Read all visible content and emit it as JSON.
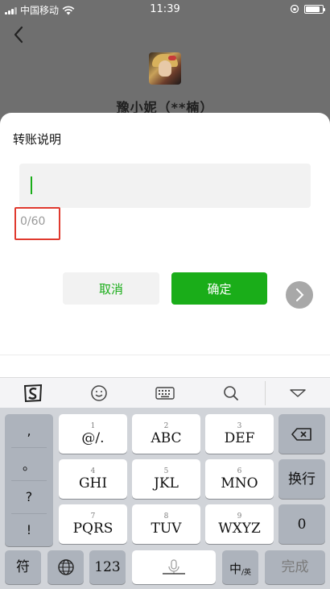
{
  "status_bar": {
    "carrier": "中国移动",
    "time": "11:39",
    "battery_level": 0.85
  },
  "header": {
    "recipient_name": "豫小妮（**楠）"
  },
  "dialog": {
    "title": "转账说明",
    "input_value": "",
    "counter": "0/60",
    "cancel_label": "取消",
    "confirm_label": "确定"
  },
  "keyboard": {
    "punctuation": [
      ",",
      "。",
      "?",
      "!"
    ],
    "keys": [
      {
        "num": "1",
        "label": "@/."
      },
      {
        "num": "2",
        "label": "ABC"
      },
      {
        "num": "3",
        "label": "DEF"
      },
      {
        "num": "4",
        "label": "GHI"
      },
      {
        "num": "5",
        "label": "JKL"
      },
      {
        "num": "6",
        "label": "MNO"
      },
      {
        "num": "7",
        "label": "PQRS"
      },
      {
        "num": "8",
        "label": "TUV"
      },
      {
        "num": "9",
        "label": "WXYZ"
      }
    ],
    "newline_label": "换行",
    "zero_label": "0",
    "symbol_label": "符",
    "numeric_label": "123",
    "lang_label": "中",
    "lang_sub": "/英",
    "done_label": "完成"
  },
  "colors": {
    "accent": "#1aad19",
    "highlight_box": "#e03a2f"
  }
}
